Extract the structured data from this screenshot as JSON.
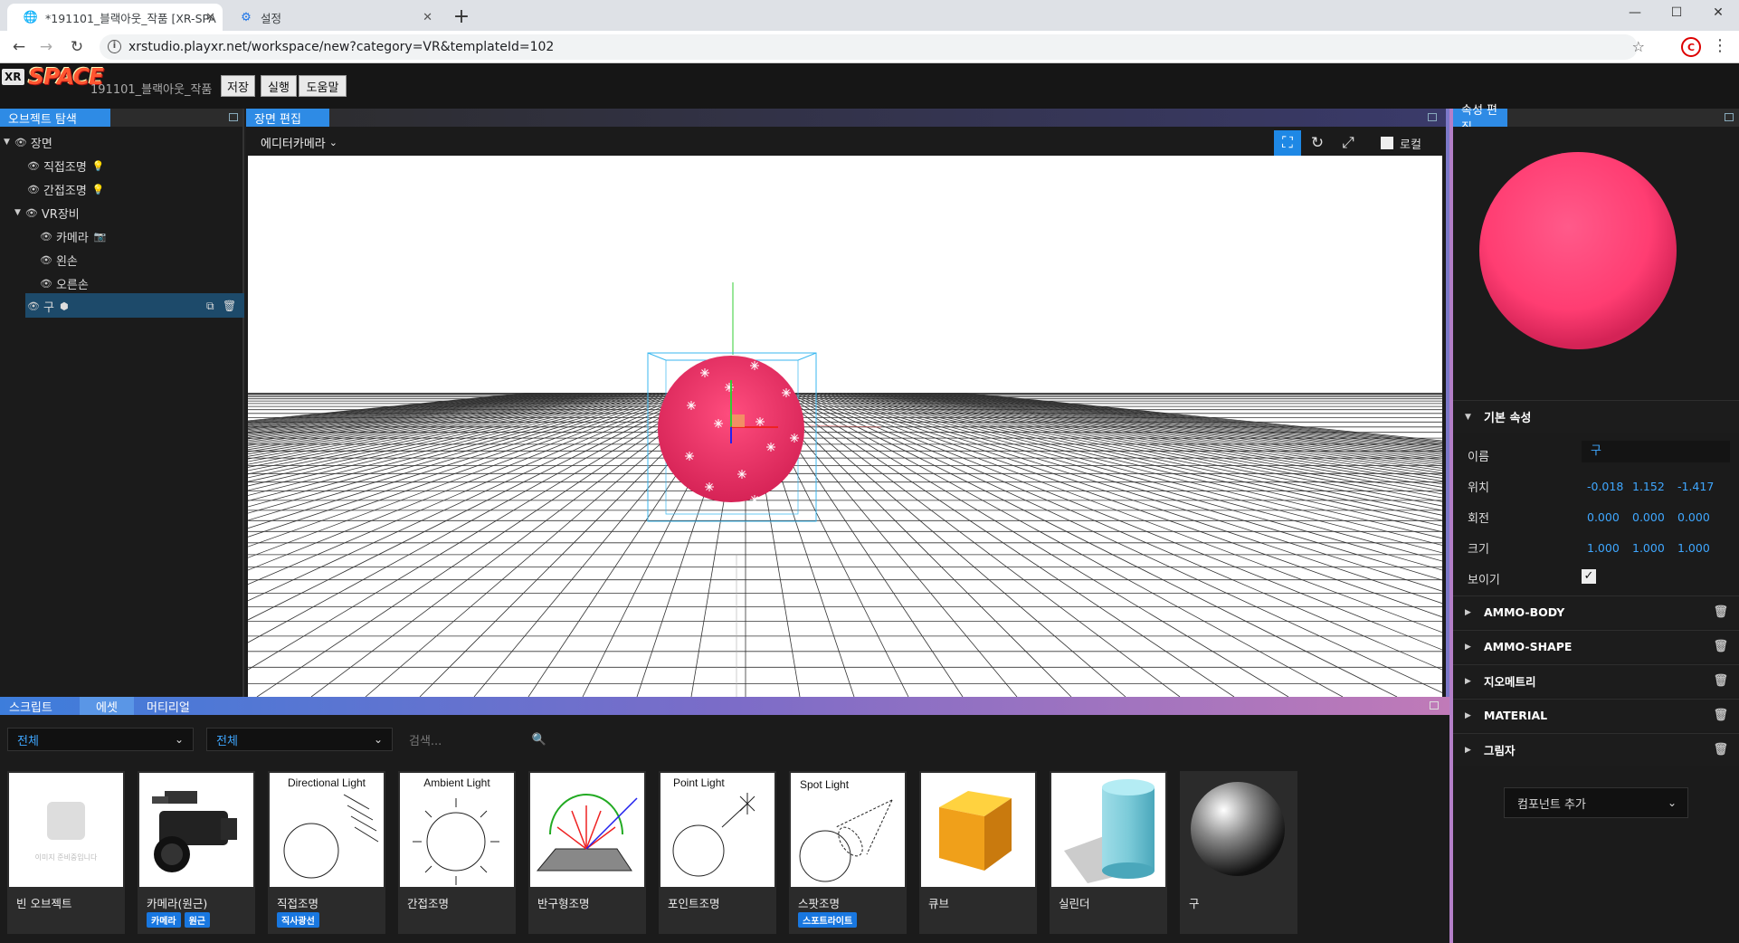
{
  "browser": {
    "tabs": [
      {
        "title": "*191101_블랙아웃_작품 [XR-SPA",
        "active": true
      },
      {
        "title": "설정",
        "active": false
      }
    ],
    "url": "xrstudio.playxr.net/workspace/new?category=VR&templateId=102",
    "window_controls": [
      "—",
      "☐",
      "✕"
    ]
  },
  "app": {
    "logo_xr": "XR",
    "logo_space": "SPACE",
    "project_name": "191101_블랙아웃_작품",
    "buttons": {
      "save": "저장",
      "run": "실행",
      "help": "도움말"
    }
  },
  "object_panel": {
    "title": "오브젝트 탐색",
    "tree": [
      {
        "label": "장면",
        "icon": ""
      },
      {
        "label": "직접조명",
        "icon": "💡"
      },
      {
        "label": "간접조명",
        "icon": "💡"
      },
      {
        "label": "VR장비",
        "icon": ""
      },
      {
        "label": "카메라",
        "icon": "📷"
      },
      {
        "label": "왼손",
        "icon": ""
      },
      {
        "label": "오른손",
        "icon": ""
      },
      {
        "label": "구",
        "icon": "⬢"
      }
    ]
  },
  "scene_panel": {
    "title": "장면 편집",
    "camera_select": "에디터카메라",
    "local_label": "로컬"
  },
  "property_panel": {
    "title": "속성 편집",
    "basic_section": "기본 속성",
    "name_label": "이름",
    "name_value": "구",
    "position_label": "위치",
    "position": [
      "-0.018",
      "1.152",
      "-1.417"
    ],
    "rotation_label": "회전",
    "rotation": [
      "0.000",
      "0.000",
      "0.000"
    ],
    "scale_label": "크기",
    "scale": [
      "1.000",
      "1.000",
      "1.000"
    ],
    "visible_label": "보이기",
    "visible": true,
    "sections": [
      "AMMO-BODY",
      "AMMO-SHAPE",
      "지오메트리",
      "MATERIAL",
      "그림자"
    ],
    "add_component": "컴포넌트 추가",
    "preview_color": "#ff3d72"
  },
  "asset_panel": {
    "tabs": [
      "스크립트",
      "에셋",
      "머티리얼"
    ],
    "active_tab": "에셋",
    "filter1": "전체",
    "filter2": "전체",
    "search_placeholder": "검색...",
    "cards": [
      {
        "label": "빈 오브젝트",
        "thumb_title": "",
        "placeholder": "이미지 준비중입니다",
        "tags": []
      },
      {
        "label": "카메라(원근)",
        "thumb_title": "",
        "tags": [
          "카메라",
          "원근"
        ]
      },
      {
        "label": "직접조명",
        "thumb_title": "Directional Light",
        "tags": [
          "직사광선"
        ]
      },
      {
        "label": "간접조명",
        "thumb_title": "Ambient Light",
        "tags": []
      },
      {
        "label": "반구형조명",
        "thumb_title": "",
        "tags": []
      },
      {
        "label": "포인트조명",
        "thumb_title": "Point Light",
        "tags": []
      },
      {
        "label": "스팟조명",
        "thumb_title": "Spot Light",
        "tags": [
          "스포트라이트"
        ]
      },
      {
        "label": "큐브",
        "thumb_title": "",
        "tags": []
      },
      {
        "label": "실린더",
        "thumb_title": "",
        "tags": []
      },
      {
        "label": "구",
        "thumb_title": "",
        "tags": []
      }
    ]
  }
}
